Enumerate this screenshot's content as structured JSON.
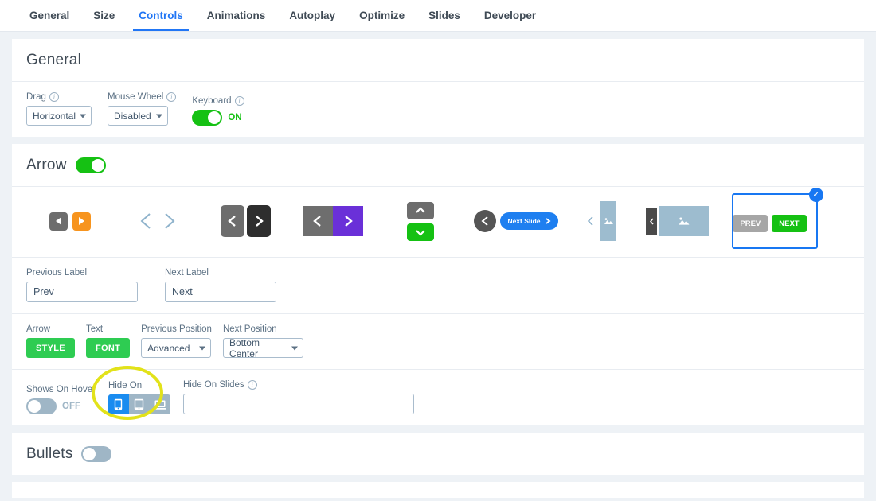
{
  "tabs": [
    {
      "label": "General",
      "active": false
    },
    {
      "label": "Size",
      "active": false
    },
    {
      "label": "Controls",
      "active": true
    },
    {
      "label": "Animations",
      "active": false
    },
    {
      "label": "Autoplay",
      "active": false
    },
    {
      "label": "Optimize",
      "active": false
    },
    {
      "label": "Slides",
      "active": false
    },
    {
      "label": "Developer",
      "active": false
    }
  ],
  "general": {
    "title": "General",
    "drag": {
      "label": "Drag",
      "value": "Horizontal",
      "info": "i"
    },
    "mouse_wheel": {
      "label": "Mouse Wheel",
      "value": "Disabled",
      "info": "i"
    },
    "keyboard": {
      "label": "Keyboard",
      "state": "ON",
      "on": true,
      "info": "i"
    }
  },
  "arrow": {
    "title": "Arrow",
    "enabled": true,
    "options": [
      {
        "name": "arrow-style-1",
        "selected": false
      },
      {
        "name": "arrow-style-2",
        "selected": false
      },
      {
        "name": "arrow-style-3",
        "selected": false
      },
      {
        "name": "arrow-style-4",
        "selected": false
      },
      {
        "name": "arrow-style-5",
        "selected": false
      },
      {
        "name": "arrow-style-6",
        "selected": false,
        "pill_label": "Next Slide"
      },
      {
        "name": "arrow-style-7",
        "selected": false
      },
      {
        "name": "arrow-style-8",
        "selected": false
      },
      {
        "name": "arrow-style-9",
        "selected": true,
        "prev_label": "PREV",
        "next_label": "NEXT"
      }
    ],
    "previous_label": {
      "label": "Previous Label",
      "value": "Prev"
    },
    "next_label": {
      "label": "Next Label",
      "value": "Next"
    },
    "arrow_style": {
      "label": "Arrow",
      "button": "STYLE"
    },
    "text_font": {
      "label": "Text",
      "button": "FONT"
    },
    "previous_position": {
      "label": "Previous Position",
      "value": "Advanced"
    },
    "next_position": {
      "label": "Next Position",
      "value": "Bottom Center"
    },
    "shows_on_hover": {
      "label": "Shows On Hover",
      "state": "OFF",
      "on": false
    },
    "hide_on": {
      "label": "Hide On",
      "devices": [
        {
          "name": "mobile",
          "active": true
        },
        {
          "name": "tablet",
          "active": false
        },
        {
          "name": "desktop",
          "active": false
        }
      ]
    },
    "hide_on_slides": {
      "label": "Hide On Slides",
      "value": "",
      "info": "i"
    }
  },
  "bullets": {
    "title": "Bullets",
    "enabled": false
  },
  "colors": {
    "accent_blue": "#2176f5",
    "green": "#15c113",
    "orange": "#f7941e",
    "purple": "#6a30d8",
    "highlight_yellow": "#e2e21a",
    "muted": "#9fb6c6"
  }
}
